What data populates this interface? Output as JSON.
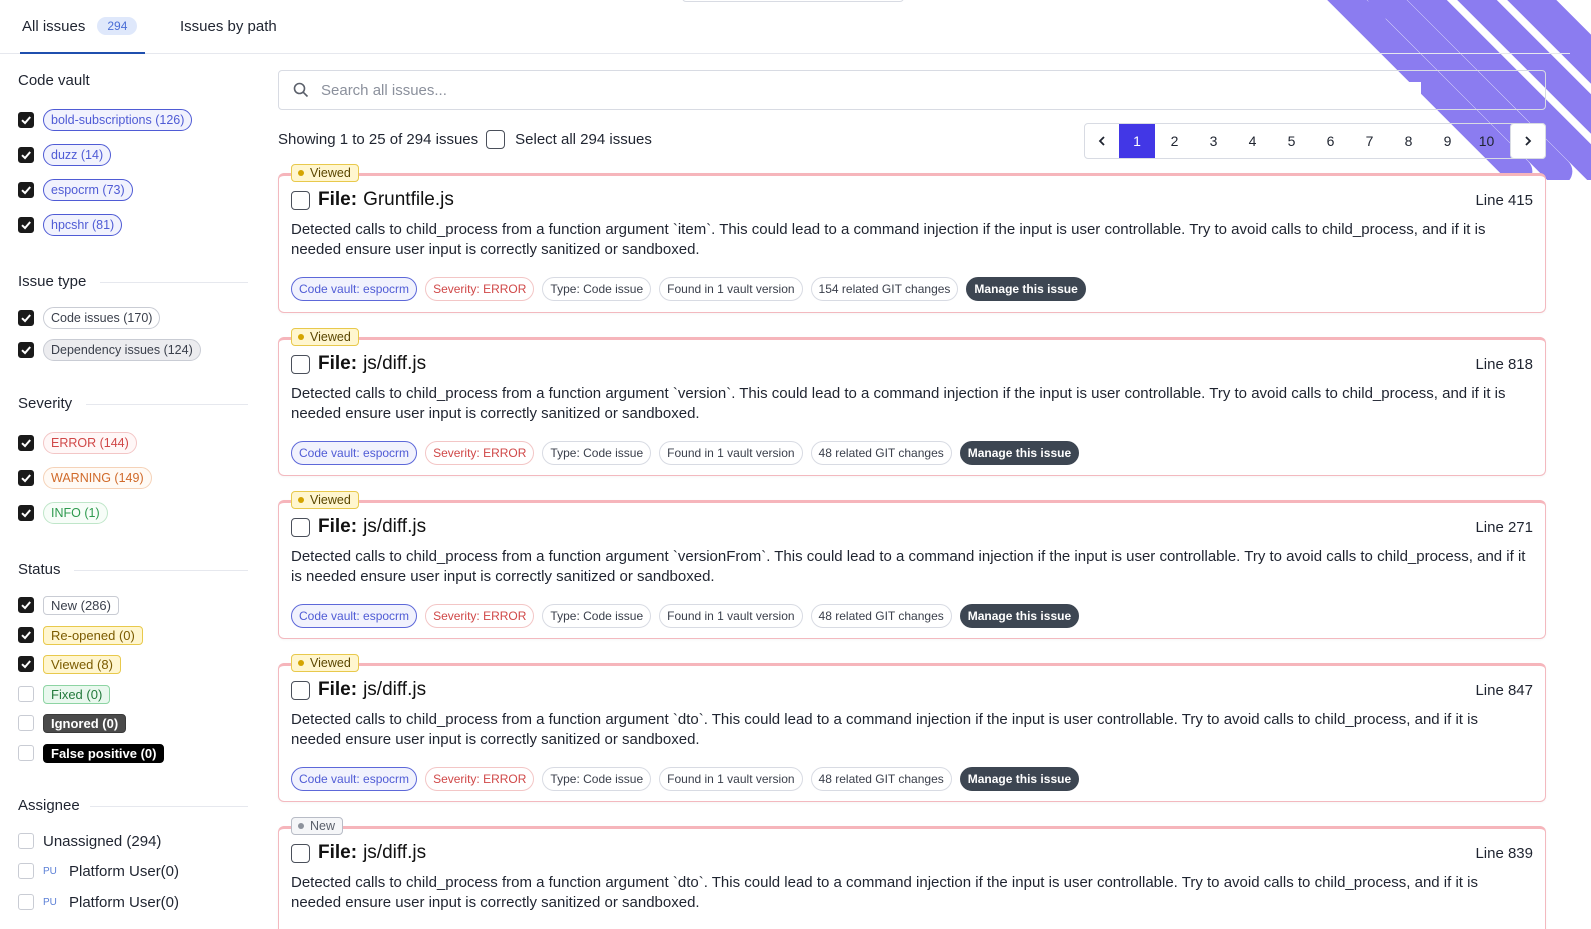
{
  "tabs": {
    "all_issues_label": "All issues",
    "all_issues_count": "294",
    "by_path_label": "Issues by path"
  },
  "sidebar": {
    "code_vault": {
      "title": "Code vault",
      "items": [
        {
          "label": "bold-subscriptions (126)",
          "checked": true
        },
        {
          "label": "duzz (14)",
          "checked": true
        },
        {
          "label": "espocrm (73)",
          "checked": true
        },
        {
          "label": "hpcshr (81)",
          "checked": true
        }
      ]
    },
    "issue_type": {
      "title": "Issue type",
      "items": [
        {
          "label": "Code issues (170)",
          "checked": true
        },
        {
          "label": "Dependency issues (124)",
          "checked": true
        }
      ]
    },
    "severity": {
      "title": "Severity",
      "items": [
        {
          "label": "ERROR (144)",
          "checked": true
        },
        {
          "label": "WARNING (149)",
          "checked": true
        },
        {
          "label": "INFO (1)",
          "checked": true
        }
      ]
    },
    "status": {
      "title": "Status",
      "items": [
        {
          "label": "New (286)",
          "checked": true
        },
        {
          "label": "Re-opened (0)",
          "checked": true
        },
        {
          "label": "Viewed (8)",
          "checked": true
        },
        {
          "label": "Fixed (0)",
          "checked": false
        },
        {
          "label": "Ignored (0)",
          "checked": false
        },
        {
          "label": "False positive (0)",
          "checked": false
        }
      ]
    },
    "assignee": {
      "title": "Assignee",
      "unassigned": "Unassigned (294)",
      "users": [
        {
          "initials": "PU",
          "label": "Platform User(0)"
        },
        {
          "initials": "PU",
          "label": "Platform User(0)"
        }
      ]
    }
  },
  "search": {
    "placeholder": "Search all issues..."
  },
  "results": {
    "showing": "Showing 1 to 25 of 294 issues",
    "select_all": "Select all 294 issues"
  },
  "pagination": {
    "pages": [
      "1",
      "2",
      "3",
      "4",
      "5",
      "6",
      "7",
      "8",
      "9",
      "10"
    ],
    "current": "1"
  },
  "issues": [
    {
      "status": "Viewed",
      "file_label": "File:",
      "file": "Gruntfile.js",
      "line": "Line 415",
      "description": "Detected calls to child_process from a function argument `item`. This could lead to a command injection if the input is user controllable. Try to avoid calls to child_process, and if it is needed ensure user input is correctly sanitized or sandboxed.",
      "tags": {
        "vault": "Code vault: espocrm",
        "severity": "Severity: ERROR",
        "type": "Type: Code issue",
        "found": "Found in 1 vault version",
        "git": "154 related GIT changes",
        "manage": "Manage this issue"
      }
    },
    {
      "status": "Viewed",
      "file_label": "File:",
      "file": "js/diff.js",
      "line": "Line 818",
      "description": "Detected calls to child_process from a function argument `version`. This could lead to a command injection if the input is user controllable. Try to avoid calls to child_process, and if it is needed ensure user input is correctly sanitized or sandboxed.",
      "tags": {
        "vault": "Code vault: espocrm",
        "severity": "Severity: ERROR",
        "type": "Type: Code issue",
        "found": "Found in 1 vault version",
        "git": "48 related GIT changes",
        "manage": "Manage this issue"
      }
    },
    {
      "status": "Viewed",
      "file_label": "File:",
      "file": "js/diff.js",
      "line": "Line 271",
      "description": "Detected calls to child_process from a function argument `versionFrom`. This could lead to a command injection if the input is user controllable. Try to avoid calls to child_process, and if it is needed ensure user input is correctly sanitized or sandboxed.",
      "tags": {
        "vault": "Code vault: espocrm",
        "severity": "Severity: ERROR",
        "type": "Type: Code issue",
        "found": "Found in 1 vault version",
        "git": "48 related GIT changes",
        "manage": "Manage this issue"
      }
    },
    {
      "status": "Viewed",
      "file_label": "File:",
      "file": "js/diff.js",
      "line": "Line 847",
      "description": "Detected calls to child_process from a function argument `dto`. This could lead to a command injection if the input is user controllable. Try to avoid calls to child_process, and if it is needed ensure user input is correctly sanitized or sandboxed.",
      "tags": {
        "vault": "Code vault: espocrm",
        "severity": "Severity: ERROR",
        "type": "Type: Code issue",
        "found": "Found in 1 vault version",
        "git": "48 related GIT changes",
        "manage": "Manage this issue"
      }
    },
    {
      "status": "New",
      "file_label": "File:",
      "file": "js/diff.js",
      "line": "Line 839",
      "description": "Detected calls to child_process from a function argument `dto`. This could lead to a command injection if the input is user controllable. Try to avoid calls to child_process, and if it is needed ensure user input is correctly sanitized or sandboxed."
    }
  ],
  "colors": {
    "accent": "#4237e6",
    "decor": "#8b7cf0",
    "card_border": "#f6b5bb"
  }
}
